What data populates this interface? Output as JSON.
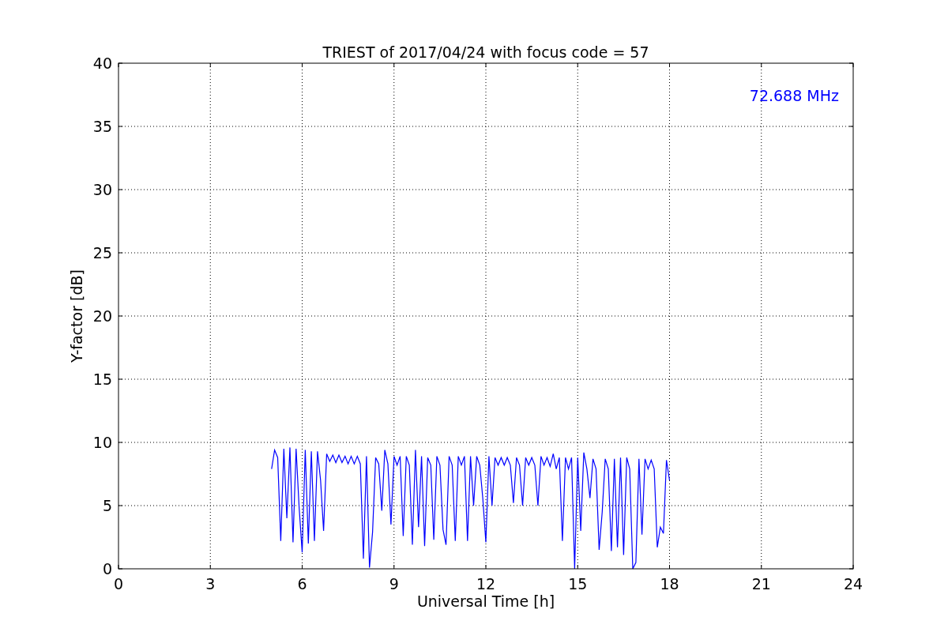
{
  "chart_data": {
    "type": "line",
    "title": "TRIEST of 2017/04/24 with focus code = 57",
    "xlabel": "Universal Time [h]",
    "ylabel": "Y-factor [dB]",
    "xlim": [
      0,
      24
    ],
    "ylim": [
      0,
      40
    ],
    "xticks": [
      0,
      3,
      6,
      9,
      12,
      15,
      18,
      21,
      24
    ],
    "yticks": [
      0,
      5,
      10,
      15,
      20,
      25,
      30,
      35,
      40
    ],
    "x": [
      5.0,
      5.1,
      5.2,
      5.3,
      5.4,
      5.5,
      5.6,
      5.7,
      5.8,
      5.9,
      6.0,
      6.1,
      6.2,
      6.3,
      6.4,
      6.5,
      6.6,
      6.7,
      6.8,
      6.9,
      7.0,
      7.1,
      7.2,
      7.3,
      7.4,
      7.5,
      7.6,
      7.7,
      7.8,
      7.9,
      8.0,
      8.1,
      8.2,
      8.3,
      8.4,
      8.5,
      8.6,
      8.7,
      8.8,
      8.9,
      9.0,
      9.1,
      9.2,
      9.3,
      9.4,
      9.5,
      9.6,
      9.7,
      9.8,
      9.9,
      10.0,
      10.1,
      10.2,
      10.3,
      10.4,
      10.5,
      10.6,
      10.7,
      10.8,
      10.9,
      11.0,
      11.1,
      11.2,
      11.3,
      11.4,
      11.5,
      11.6,
      11.7,
      11.8,
      11.9,
      12.0,
      12.1,
      12.2,
      12.3,
      12.4,
      12.5,
      12.6,
      12.7,
      12.8,
      12.9,
      13.0,
      13.1,
      13.2,
      13.3,
      13.4,
      13.5,
      13.6,
      13.7,
      13.8,
      13.9,
      14.0,
      14.1,
      14.2,
      14.3,
      14.4,
      14.5,
      14.6,
      14.7,
      14.8,
      14.9,
      15.0,
      15.1,
      15.2,
      15.3,
      15.4,
      15.5,
      15.6,
      15.7,
      15.8,
      15.9,
      16.0,
      16.1,
      16.2,
      16.3,
      16.4,
      16.5,
      16.6,
      16.7,
      16.8,
      16.9,
      17.0,
      17.1,
      17.2,
      17.3,
      17.4,
      17.5,
      17.6,
      17.7,
      17.8,
      17.9,
      18.0
    ],
    "series": [
      {
        "name": "72.688 MHz",
        "color": "#0000ff",
        "values": [
          7.9,
          9.4,
          8.8,
          2.2,
          9.5,
          4.0,
          9.6,
          2.1,
          9.5,
          4.9,
          1.3,
          9.4,
          2.0,
          9.3,
          2.2,
          9.3,
          7.0,
          3.0,
          9.1,
          8.5,
          9.0,
          8.4,
          9.0,
          8.4,
          8.9,
          8.3,
          8.9,
          8.3,
          8.9,
          8.3,
          0.8,
          8.9,
          0.1,
          2.9,
          8.8,
          8.3,
          4.6,
          9.4,
          8.3,
          3.5,
          8.9,
          8.2,
          8.9,
          2.6,
          8.9,
          8.2,
          1.9,
          9.4,
          3.3,
          8.9,
          1.8,
          8.8,
          8.2,
          2.3,
          8.9,
          8.2,
          3.1,
          1.9,
          8.9,
          8.2,
          2.2,
          8.9,
          8.2,
          8.9,
          2.2,
          8.9,
          5.0,
          8.9,
          8.2,
          5.6,
          2.1,
          8.9,
          5.0,
          8.8,
          8.2,
          8.8,
          8.2,
          8.8,
          8.2,
          5.2,
          8.8,
          8.2,
          5.0,
          8.8,
          8.2,
          8.8,
          8.2,
          5.0,
          8.9,
          8.2,
          8.8,
          8.1,
          9.1,
          7.9,
          8.8,
          2.2,
          8.8,
          7.9,
          8.8,
          0.0,
          8.8,
          3.0,
          9.2,
          7.9,
          5.6,
          8.7,
          7.9,
          1.5,
          4.5,
          8.7,
          7.9,
          1.4,
          8.7,
          1.7,
          8.8,
          1.1,
          8.8,
          7.9,
          0.0,
          0.5,
          8.7,
          2.7,
          8.7,
          7.9,
          8.6,
          7.9,
          1.7,
          3.3,
          2.8,
          8.6,
          7.0
        ]
      }
    ],
    "grid": true
  }
}
